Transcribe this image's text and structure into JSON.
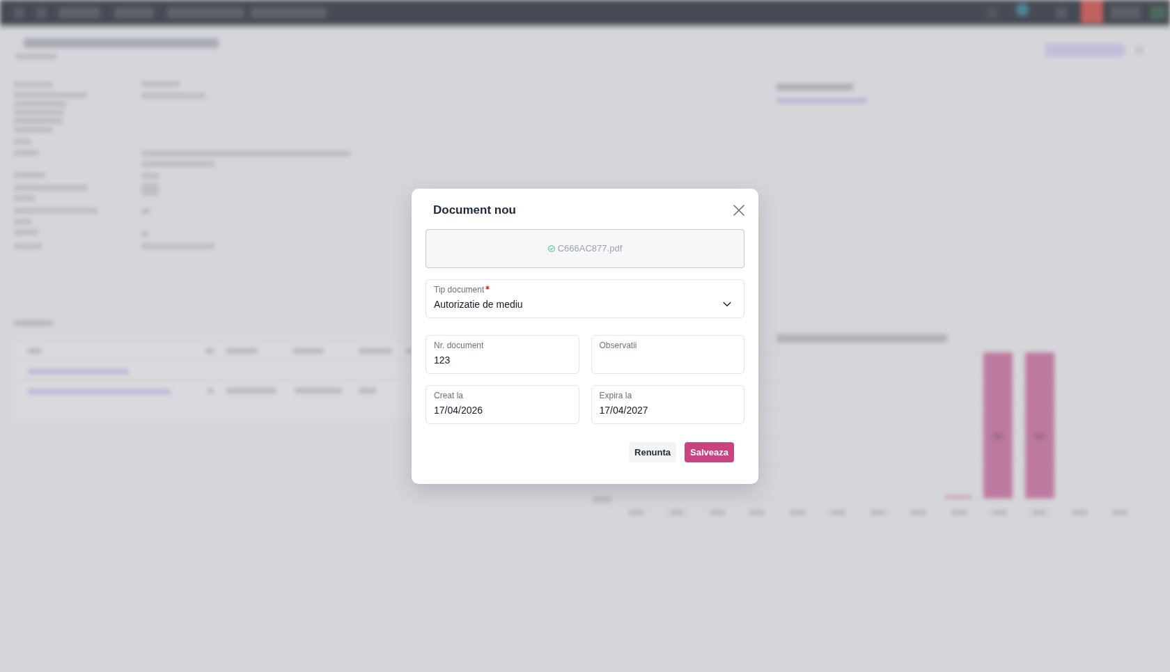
{
  "dialog": {
    "title": "Document nou",
    "upload": {
      "file_name": "C666AC877.pdf"
    },
    "rows": [
      [
        {
          "kind": "select",
          "label": "Tip document",
          "required": true,
          "value": "Autorizatie de mediu"
        }
      ],
      [
        {
          "kind": "text",
          "label": "Nr. document",
          "required": false,
          "value": "123"
        },
        {
          "kind": "text",
          "label": "Observatii",
          "required": false
        }
      ],
      [
        {
          "kind": "text",
          "label": "Creat la",
          "required": false,
          "value": "17/04/2026"
        },
        {
          "kind": "text",
          "label": "Expira la",
          "required": false,
          "value": "17/04/2027"
        }
      ]
    ],
    "buttons": [
      {
        "kind": "secondary",
        "label": "Renunta"
      },
      {
        "kind": "primary",
        "label": "Salveaza"
      }
    ]
  }
}
